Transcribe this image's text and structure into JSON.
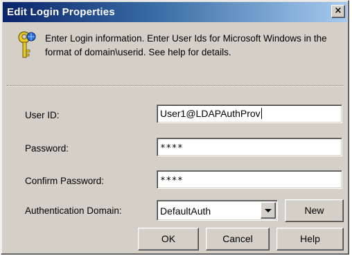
{
  "dialog": {
    "title": "Edit Login Properties",
    "close_label": "×"
  },
  "info": {
    "icon": "key-icon",
    "text": "Enter Login information. Enter User Ids for Microsoft Windows in the format of domain\\userid. See help for details."
  },
  "form": {
    "user_id_label": "User ID:",
    "user_id_value": "User1@LDAPAuthProv",
    "password_label": "Password:",
    "password_value": "****",
    "confirm_password_label": "Confirm Password:",
    "confirm_password_value": "****",
    "auth_domain_label": "Authentication Domain:",
    "auth_domain_value": "DefaultAuth"
  },
  "buttons": {
    "new_label": "New",
    "ok_label": "OK",
    "cancel_label": "Cancel",
    "help_label": "Help"
  },
  "colors": {
    "titlebar_start": "#0a246a",
    "titlebar_end": "#a6caf0",
    "dialog_face": "#d4d0c8"
  }
}
